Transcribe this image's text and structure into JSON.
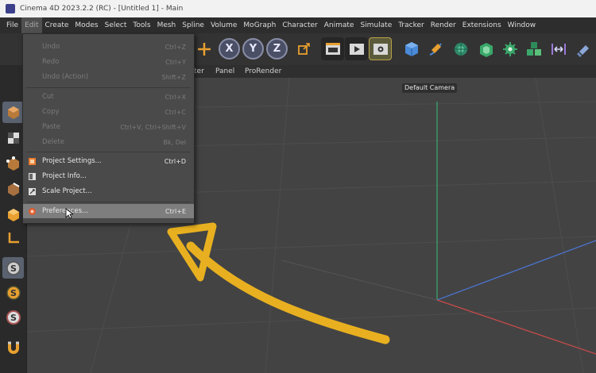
{
  "window": {
    "title": "Cinema 4D 2023.2.2 (RC) - [Untitled 1] - Main"
  },
  "menubar": {
    "items": [
      "File",
      "Edit",
      "Create",
      "Modes",
      "Select",
      "Tools",
      "Mesh",
      "Spline",
      "Volume",
      "MoGraph",
      "Character",
      "Animate",
      "Simulate",
      "Tracker",
      "Render",
      "Extensions",
      "Window"
    ],
    "active": "Edit"
  },
  "toolbar": {
    "axis_x": "X",
    "axis_y": "Y",
    "axis_z": "Z",
    "icons": [
      "coordinate-system-icon",
      "render-view-icon",
      "render-to-picture-viewer-icon",
      "render-settings-icon",
      "cube-icon",
      "pen-icon",
      "subdivision-icon",
      "extrude-icon",
      "cloner-icon",
      "fracture-icon",
      "deformer-icon",
      "environment-icon"
    ]
  },
  "viewport": {
    "menus": [
      "ter",
      "Panel",
      "ProRender"
    ],
    "camera_label": "Default Camera"
  },
  "edit_menu": {
    "items": [
      {
        "label": "Undo",
        "shortcut": "Ctrl+Z",
        "enabled": false
      },
      {
        "label": "Redo",
        "shortcut": "Ctrl+Y",
        "enabled": false
      },
      {
        "label": "Undo (Action)",
        "shortcut": "Shift+Z",
        "enabled": false
      },
      {
        "label": "Cut",
        "shortcut": "Ctrl+X",
        "enabled": false
      },
      {
        "label": "Copy",
        "shortcut": "Ctrl+C",
        "enabled": false
      },
      {
        "label": "Paste",
        "shortcut": "Ctrl+V, Ctrl+Shift+V",
        "enabled": false
      },
      {
        "label": "Delete",
        "shortcut": "Bk, Del",
        "enabled": false
      },
      {
        "label": "Project Settings...",
        "shortcut": "Ctrl+D",
        "enabled": true
      },
      {
        "label": "Project Info...",
        "shortcut": "",
        "enabled": true
      },
      {
        "label": "Scale Project...",
        "shortcut": "",
        "enabled": true
      },
      {
        "label": "Preferences...",
        "shortcut": "Ctrl+E",
        "enabled": true,
        "hover": true
      }
    ]
  },
  "colors": {
    "menubar_bg": "#2d2d2d",
    "viewport_bg": "#434343",
    "axis_x": "#c84a4a",
    "axis_y": "#3aa36a",
    "axis_z": "#4a72c8",
    "annotation_arrow": "#e8b020"
  }
}
